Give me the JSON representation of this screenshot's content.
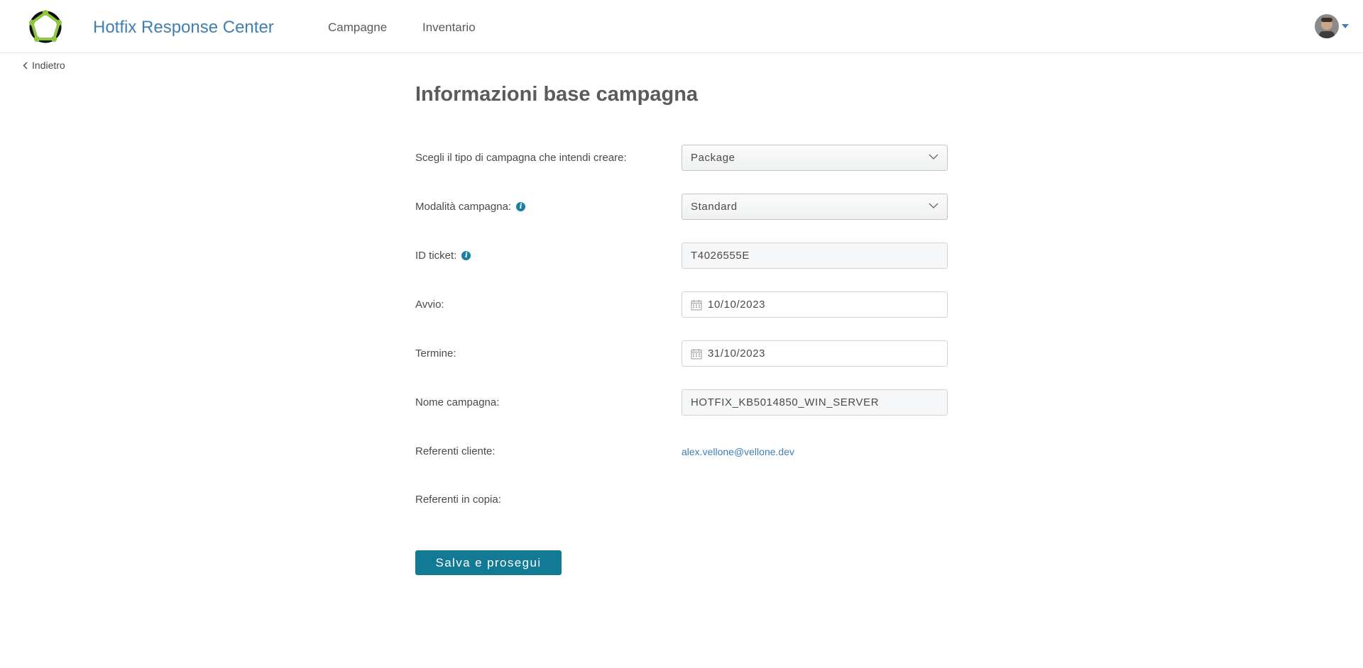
{
  "app": {
    "title": "Hotfix Response Center"
  },
  "nav": {
    "items": [
      {
        "label": "Campagne"
      },
      {
        "label": "Inventario"
      }
    ]
  },
  "back": {
    "label": "Indietro"
  },
  "page": {
    "title": "Informazioni base campagna"
  },
  "form": {
    "tipo": {
      "label": "Scegli il tipo di campagna che intendi creare:",
      "value": "Package"
    },
    "modalita": {
      "label": "Modalità campagna:",
      "value": "Standard"
    },
    "ticket": {
      "label": "ID ticket:",
      "value": "T4026555E"
    },
    "avvio": {
      "label": "Avvio:",
      "value": "10/10/2023"
    },
    "termine": {
      "label": "Termine:",
      "value": "31/10/2023"
    },
    "nome": {
      "label": "Nome campagna:",
      "value": "HOTFIX_KB5014850_WIN_SERVER"
    },
    "referenti": {
      "label": "Referenti cliente:",
      "value": "alex.vellone@vellone.dev"
    },
    "copia": {
      "label": "Referenti in copia:"
    }
  },
  "actions": {
    "save_label": "Salva e prosegui"
  },
  "colors": {
    "accent": "#137a96",
    "link": "#3f7fb3",
    "logo_green": "#8dc63f"
  },
  "icons": [
    "logo-icon",
    "chevron-left-icon",
    "chevron-down-icon",
    "info-icon",
    "calendar-icon",
    "avatar",
    "caret-down-icon"
  ]
}
